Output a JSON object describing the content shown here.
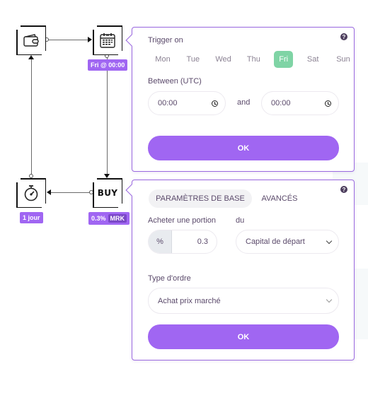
{
  "flow": {
    "nodes": {
      "wallet": {
        "icon": "wallet-icon"
      },
      "calendar": {
        "icon": "calendar-icon",
        "badge": "Fri @ 00:00"
      },
      "buy": {
        "label": "BUY",
        "badge_value": "0.3%",
        "badge_type": "MRK"
      },
      "timer": {
        "icon": "stopwatch-icon",
        "badge": "1 jour"
      }
    }
  },
  "trigger_panel": {
    "title": "Trigger on",
    "days": [
      {
        "label": "Mon",
        "active": false
      },
      {
        "label": "Tue",
        "active": false
      },
      {
        "label": "Wed",
        "active": false
      },
      {
        "label": "Thu",
        "active": false
      },
      {
        "label": "Fri",
        "active": true
      },
      {
        "label": "Sat",
        "active": false
      },
      {
        "label": "Sun",
        "active": false
      }
    ],
    "between_label": "Between (UTC)",
    "start_time": "00:00",
    "and_label": "and",
    "end_time": "00:00",
    "ok_label": "OK",
    "help": "?"
  },
  "buy_panel": {
    "tabs": [
      {
        "label": "PARAMÈTRES DE BASE",
        "active": true
      },
      {
        "label": "AVANCÉS",
        "active": false
      }
    ],
    "portion_label": "Acheter une portion",
    "portion_unit": "%",
    "portion_value": "0.3",
    "of_label": "du",
    "capital_select": "Capital de départ",
    "order_type_label": "Type d'ordre",
    "order_type_select": "Achat prix marché",
    "ok_label": "OK",
    "help": "?"
  },
  "colors": {
    "accent": "#a066f2",
    "active_day": "#7fd4a5",
    "border": "#9b6ae0"
  }
}
